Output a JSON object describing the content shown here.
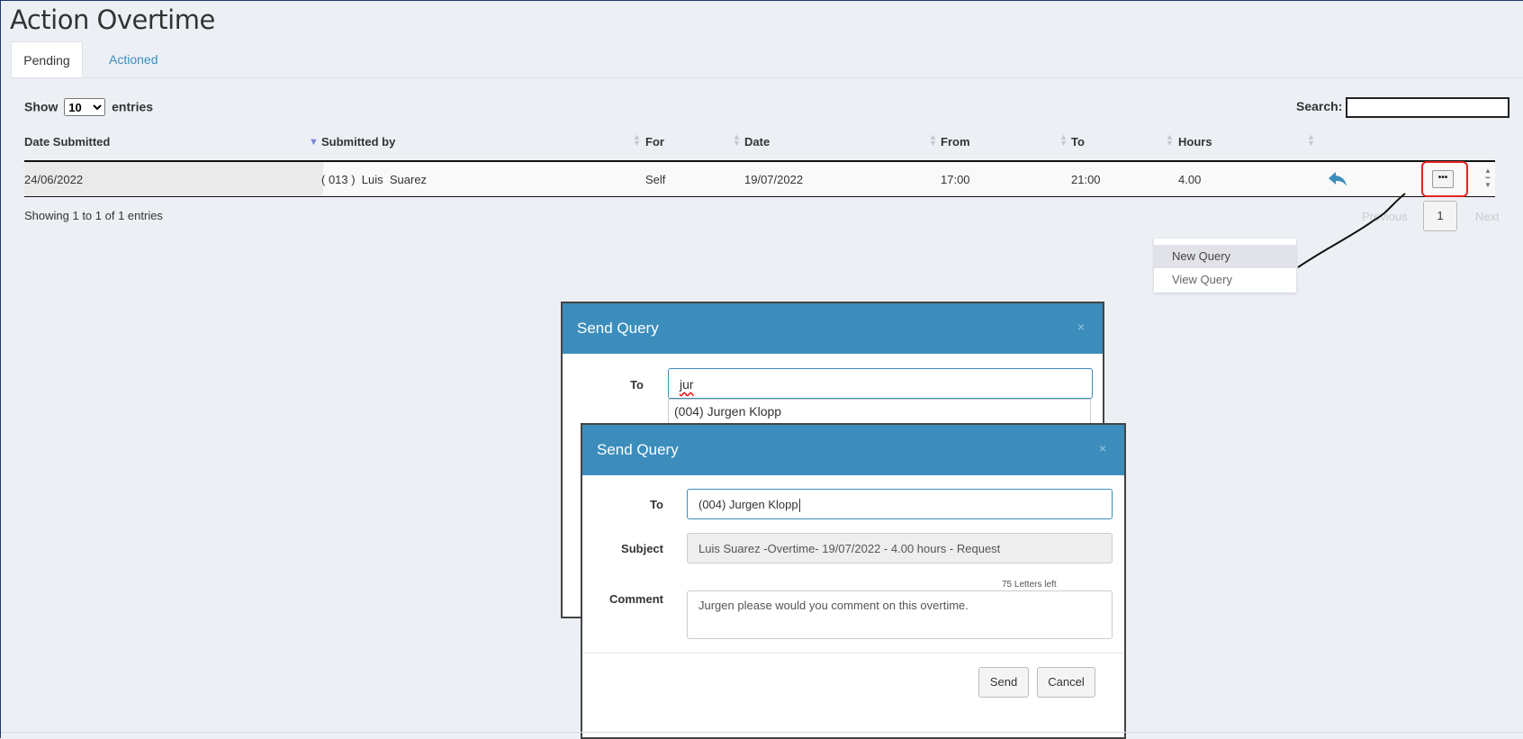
{
  "page": {
    "title": "Action Overtime"
  },
  "tabs": [
    {
      "label": "Pending",
      "active": true
    },
    {
      "label": "Actioned",
      "active": false
    }
  ],
  "table_controls": {
    "show_label": "Show",
    "entries_value": "10",
    "entries_label": "entries",
    "search_label": "Search:",
    "search_value": ""
  },
  "table": {
    "columns": [
      "Date Submitted",
      "Submitted by",
      "For",
      "Date",
      "From",
      "To",
      "Hours"
    ],
    "rows": [
      {
        "date_submitted": "24/06/2022",
        "submitted_by": "( 013 )  Luis  Suarez",
        "for": "Self",
        "date": "19/07/2022",
        "from": "17:00",
        "to": "21:00",
        "hours": "4.00"
      }
    ],
    "actions_icon": "reply-icon",
    "menu_icon": "ellipsis-icon"
  },
  "pagination": {
    "info": "Showing 1 to 1 of 1 entries",
    "previous": "Previous",
    "page": "1",
    "next": "Next"
  },
  "dropdown_menu": {
    "items": [
      "New Query",
      "View Query"
    ]
  },
  "modal_back": {
    "title": "Send Query",
    "close": "×",
    "to_label": "To",
    "to_value": "jur",
    "suggestion": "(004) Jurgen Klopp"
  },
  "modal_front": {
    "title": "Send Query",
    "close": "×",
    "to_label": "To",
    "to_value": "(004) Jurgen Klopp",
    "subject_label": "Subject",
    "subject_value": "Luis Suarez -Overtime- 19/07/2022 - 4.00 hours - Request",
    "comment_label": "Comment",
    "letters_left": "75 Letters left",
    "comment_value": "Jurgen please would you comment on this overtime.",
    "send_label": "Send",
    "cancel_label": "Cancel"
  },
  "colors": {
    "header_blue": "#3c8dbc",
    "highlight_red": "#e32420",
    "background": "#ecf0f5"
  }
}
